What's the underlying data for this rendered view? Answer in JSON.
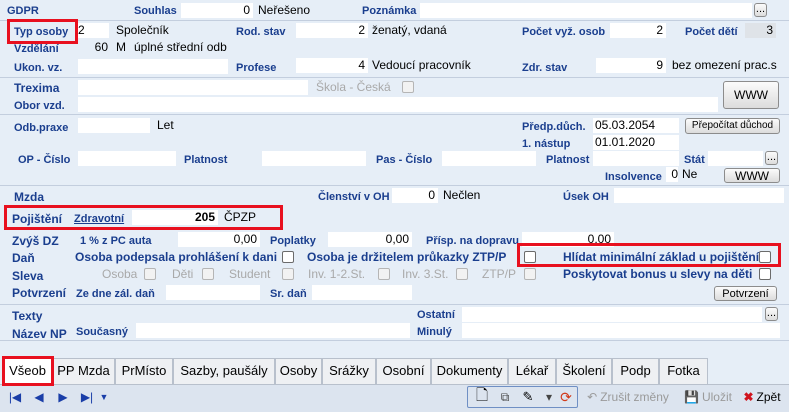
{
  "header": {
    "gdpr": "GDPR",
    "souhlas": "Souhlas",
    "souhlas_value": "0",
    "souhlas_text": "Neřešeno",
    "poznamka": "Poznámka",
    "dots": "..."
  },
  "row1": {
    "typ_osoby": "Typ osoby",
    "typ_code": "2",
    "typ_text": "Společník",
    "rod_stav": "Rod. stav",
    "rod_code": "2",
    "rod_text": "ženatý, vdaná",
    "pocet_vyz": "Počet vyž. osob",
    "pocet_vyz_value": "2",
    "pocet_deti": "Počet dětí",
    "pocet_deti_value": "3"
  },
  "row2": {
    "vzdelani": "Vzdělání",
    "vzd_code": "60",
    "vzd_letter": "M",
    "vzd_text": "úplné střední odb"
  },
  "row3": {
    "ukon": "Ukon. vz.",
    "profese": "Profese",
    "profese_code": "4",
    "profese_text": "Vedoucí pracovník",
    "zdr_stav": "Zdr. stav",
    "zdr_code": "9",
    "zdr_text": "bez omezení prac.s"
  },
  "trexima": {
    "label": "Trexima",
    "skola": "Škola - Česká",
    "obor": "Obor vzd.",
    "www": "WWW"
  },
  "praxe": {
    "odb_praxe": "Odb.praxe",
    "let": "Let",
    "predp": "Předp.důch.",
    "predp_value": "05.03.2054",
    "nastup": "1. nástup",
    "nastup_value": "01.01.2020",
    "prepocitat": "Přepočítat důchod"
  },
  "op": {
    "op_cislo": "OP - Číslo",
    "platnost": "Platnost",
    "pas_cislo": "Pas - Číslo",
    "platnost2": "Platnost",
    "stat": "Stát",
    "insolvence": "Insolvence",
    "insolvence_value": "0",
    "insolvence_text": "Ne",
    "www": "WWW",
    "dots": "..."
  },
  "mzda": {
    "label": "Mzda",
    "clenstvi": "Členství v OH",
    "clenstvi_value": "0",
    "clenstvi_text": "Nečlen",
    "usek": "Úsek OH"
  },
  "pojisteni": {
    "label": "Pojištění",
    "typ": "Zdravotní",
    "code": "205",
    "name": "ČPZP"
  },
  "zvys": {
    "label": "Zvýš DZ",
    "pc_auta": "1 % z PC auta",
    "pc_value": "0,00",
    "poplatky": "Poplatky",
    "poplatky_value": "0,00",
    "prisp": "Přísp. na dopravu",
    "prisp_value": "0,00"
  },
  "dan": {
    "label": "Daň",
    "prohlaseni": "Osoba podepsala prohlášení k dani",
    "ztp": "Osoba je držitelem průkazky ZTP/P",
    "hlidat": "Hlídat minimální základ u pojištění"
  },
  "sleva": {
    "label": "Sleva",
    "osoba": "Osoba",
    "deti": "Děti",
    "student": "Student",
    "inv12": "Inv. 1-2.St.",
    "inv3": "Inv. 3.St.",
    "ztpp": "ZTP/P",
    "bonus": "Poskytovat bonus u slevy na děti"
  },
  "potvrzeni": {
    "label": "Potvrzení",
    "ze_dne": "Ze dne zál. daň",
    "sr_dan": "Sr. daň",
    "button": "Potvrzení"
  },
  "texty": {
    "label": "Texty",
    "ostatni": "Ostatní",
    "dots": "...",
    "nazev_np": "Název NP",
    "soucasny": "Současný",
    "minuly": "Minulý"
  },
  "tabs": [
    "Všeob",
    "PP Mzda",
    "PrMísto",
    "Sazby, paušály",
    "Osoby",
    "Srážky",
    "Osobní",
    "Dokumenty",
    "Lékař",
    "Školení",
    "Podp",
    "Fotka"
  ],
  "toolbar": {
    "zrusit": "Zrušit změny",
    "ulozit": "Uložit",
    "zpet": "Zpět"
  }
}
